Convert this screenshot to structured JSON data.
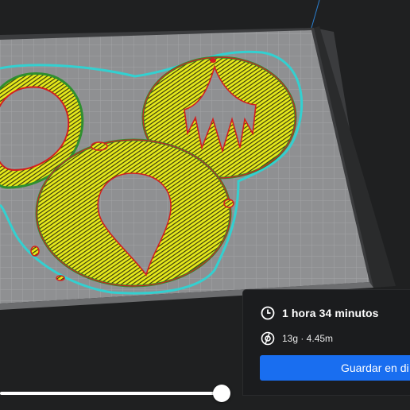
{
  "print_info": {
    "time_icon": "clock-icon",
    "time": "1 hora 34 minutos",
    "material_icon": "filament-spool-icon",
    "material": "13g · 4.45m",
    "save_button": "Guardar en di"
  },
  "layer_slider": {
    "value_fraction": 1.0
  },
  "colors": {
    "background": "#1f2021",
    "build_plate": "#8d8e90",
    "infill": "#e6ea1a",
    "infill_lines": "#3a3a10",
    "wall_outer": "#d21f1f",
    "wall_inner": "#2f8f2f",
    "skirt": "#33d0d0",
    "accent": "#196ef0",
    "panel": "#1b1c1e"
  }
}
